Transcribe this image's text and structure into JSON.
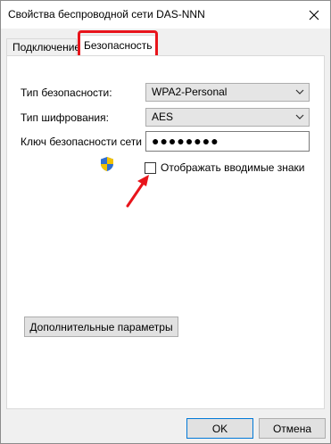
{
  "window": {
    "title": "Свойства беспроводной сети DAS-NNN",
    "close_icon": "close-icon"
  },
  "tabs": [
    {
      "label": "Подключение",
      "selected": false
    },
    {
      "label": "Безопасность",
      "selected": true
    }
  ],
  "security": {
    "security_type_label": "Тип безопасности:",
    "security_type_value": "WPA2-Personal",
    "encryption_type_label": "Тип шифрования:",
    "encryption_type_value": "AES",
    "key_label": "Ключ безопасности сети",
    "key_value": "●●●●●●●●",
    "show_chars_label": "Отображать вводимые знаки",
    "show_chars_checked": false,
    "advanced_button": "Дополнительные параметры"
  },
  "footer": {
    "ok_label": "OK",
    "cancel_label": "Отмена"
  },
  "colors": {
    "highlight": "#e8141b",
    "arrow": "#e8141b",
    "ok_border": "#0078d7"
  },
  "icons": [
    "close-icon",
    "chevron-down-icon",
    "uac-shield-icon",
    "red-arrow-icon"
  ]
}
